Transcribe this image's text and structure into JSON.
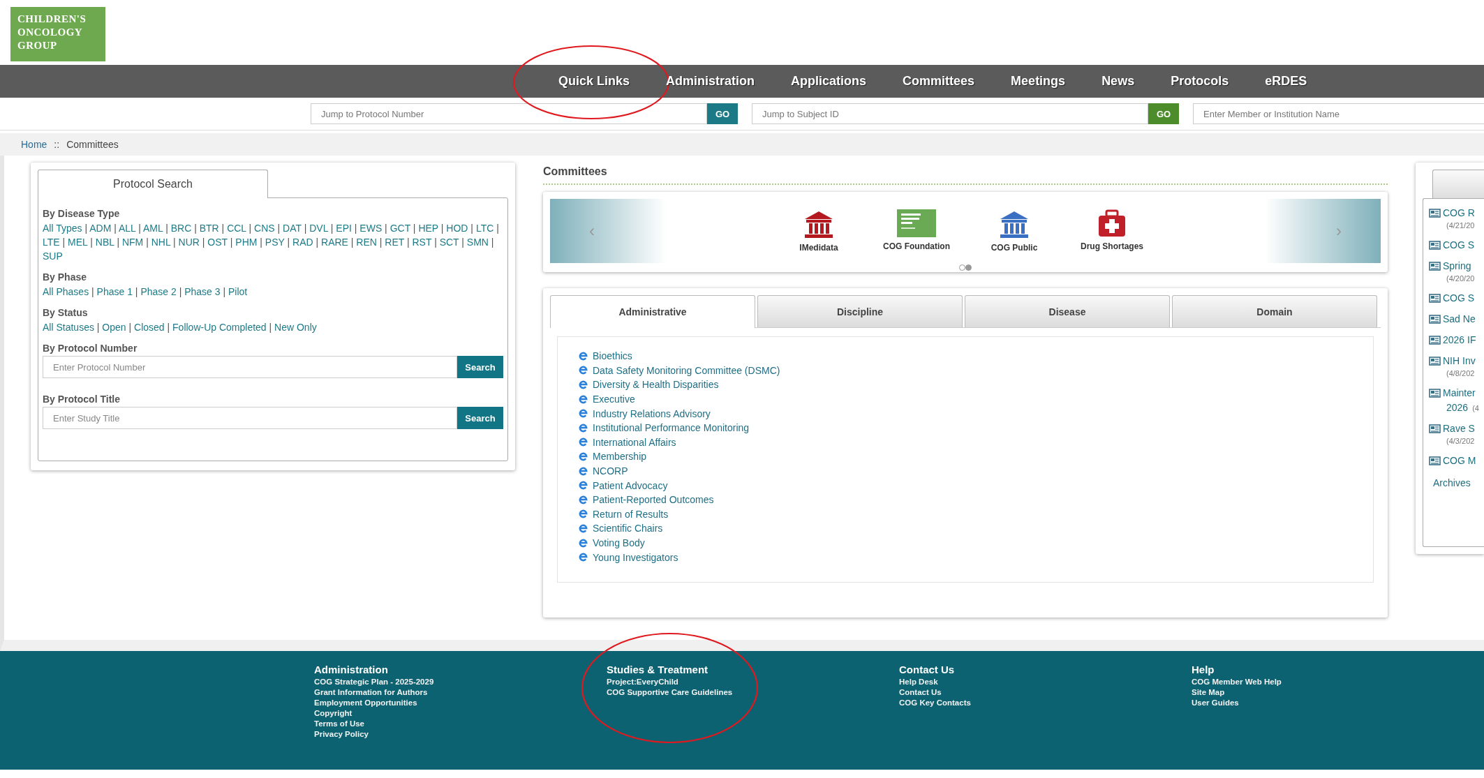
{
  "logo": {
    "text": "CHILDREN'S ONCOLOGY GROUP"
  },
  "nav": [
    {
      "label": "Quick Links",
      "circled": true
    },
    {
      "label": "Administration",
      "circled": false
    },
    {
      "label": "Applications",
      "circled": false
    },
    {
      "label": "Committees",
      "circled": false
    },
    {
      "label": "Meetings",
      "circled": false
    },
    {
      "label": "News",
      "circled": false
    },
    {
      "label": "Protocols",
      "circled": false
    },
    {
      "label": "eRDES",
      "circled": false
    }
  ],
  "jump_fields": [
    {
      "placeholder": "Jump to Protocol Number",
      "button": "GO",
      "color": "#1b7a86"
    },
    {
      "placeholder": "Jump to Subject ID",
      "button": "GO",
      "color": "#4c8c2a"
    },
    {
      "placeholder": "Enter Member or Institution Name"
    }
  ],
  "breadcrumb": {
    "home": "Home",
    "separator": "::",
    "current": "Committees"
  },
  "protocol_search": {
    "tab": "Protocol Search",
    "separator": "|",
    "groups": [
      {
        "heading": "By Disease Type",
        "links": [
          "All Types",
          "ADM",
          "ALL",
          "AML",
          "BRC",
          "BTR",
          "CCL",
          "CNS",
          "DAT",
          "DVL",
          "EPI",
          "EWS",
          "GCT",
          "HEP",
          "HOD",
          "LTC",
          "LTE",
          "MEL",
          "NBL",
          "NFM",
          "NHL",
          "NUR",
          "OST",
          "PHM",
          "PSY",
          "RAD",
          "RARE",
          "REN",
          "RET",
          "RST",
          "SCT",
          "SMN",
          "SUP"
        ]
      },
      {
        "heading": "By Phase",
        "links": [
          "All Phases",
          "Phase 1",
          "Phase 2",
          "Phase 3",
          "Pilot"
        ]
      },
      {
        "heading": "By Status",
        "links": [
          "All Statuses",
          "Open",
          "Closed",
          "Follow-Up Completed",
          "New Only"
        ]
      }
    ],
    "fields": [
      {
        "heading": "By Protocol Number",
        "placeholder": "Enter Protocol Number",
        "button": "Search"
      },
      {
        "heading": "By Protocol Title",
        "placeholder": "Enter Study Title",
        "button": "Search"
      }
    ]
  },
  "committees": {
    "title": "Committees",
    "carousel": {
      "prev": "‹",
      "next": "›",
      "items": [
        {
          "kind": "bank",
          "color": "#b3191f",
          "label": "IMedidata"
        },
        {
          "kind": "logo",
          "color": "#6aaa55",
          "label": "COG Foundation"
        },
        {
          "kind": "bank",
          "color": "#3a6fc4",
          "label": "COG Public"
        },
        {
          "kind": "medkit",
          "color": "#c0202a",
          "label": "Drug Shortages"
        }
      ],
      "dots": [
        {
          "selected": false
        },
        {
          "selected": true
        }
      ]
    },
    "tabs": [
      {
        "label": "Administrative",
        "selected": true
      },
      {
        "label": "Discipline",
        "selected": false
      },
      {
        "label": "Disease",
        "selected": false
      },
      {
        "label": "Domain",
        "selected": false
      }
    ],
    "items": [
      "Bioethics",
      "Data Safety Monitoring Committee (DSMC)",
      "Diversity & Health Disparities",
      "Executive",
      "Industry Relations Advisory",
      "Institutional Performance Monitoring",
      "International Affairs",
      "Membership",
      "NCORP",
      "Patient Advocacy",
      "Patient-Reported Outcomes",
      "Return of Results",
      "Scientific Chairs",
      "Voting Body",
      "Young Investigators"
    ]
  },
  "news": {
    "items": [
      {
        "title": "COG R",
        "date": "(4/21/20"
      },
      {
        "title": "COG S"
      },
      {
        "title": "Spring",
        "date": "(4/20/20"
      },
      {
        "title": "COG S"
      },
      {
        "title": "Sad Ne"
      },
      {
        "title": "2026 IF"
      },
      {
        "title": "NIH Inv",
        "date": "(4/8/202"
      },
      {
        "title": "Mainter",
        "title_line2": "2026",
        "date": "(4"
      },
      {
        "title": "Rave S",
        "date": "(4/3/202"
      },
      {
        "title": "COG M"
      }
    ],
    "archives": "Archives"
  },
  "footer": [
    {
      "heading": "Administration",
      "circled": false,
      "links": [
        "COG Strategic Plan - 2025-2029",
        "Grant Information for Authors",
        "Employment Opportunities",
        "Copyright",
        "Terms of Use",
        "Privacy Policy"
      ]
    },
    {
      "heading": "Studies & Treatment",
      "circled": true,
      "links": [
        "Project:EveryChild",
        "COG Supportive Care Guidelines"
      ]
    },
    {
      "heading": "Contact Us",
      "circled": false,
      "links": [
        "Help Desk",
        "Contact Us",
        "COG Key Contacts"
      ]
    },
    {
      "heading": "Help",
      "circled": false,
      "links": [
        "COG Member Web Help",
        "Site Map",
        "User Guides"
      ]
    }
  ]
}
